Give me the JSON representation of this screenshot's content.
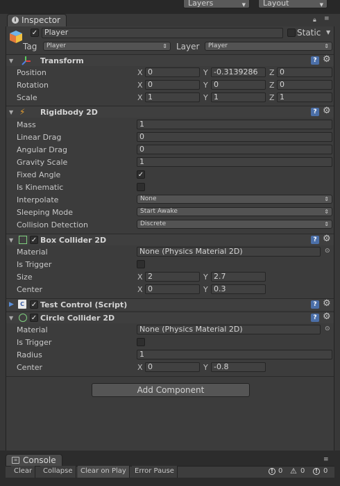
{
  "topbar": {
    "layers_label": "Layers",
    "layout_label": "Layout"
  },
  "inspector": {
    "tab_label": "Inspector",
    "object_name": "Player",
    "static_label": "Static",
    "tag_label": "Tag",
    "tag_value": "Player",
    "layer_label": "Layer",
    "layer_value": "Player"
  },
  "transform": {
    "title": "Transform",
    "position_label": "Position",
    "position": {
      "x": "0",
      "y": "-0.3139286",
      "z": "0"
    },
    "rotation_label": "Rotation",
    "rotation": {
      "x": "0",
      "y": "0",
      "z": "0"
    },
    "scale_label": "Scale",
    "scale": {
      "x": "1",
      "y": "1",
      "z": "1"
    }
  },
  "axis": {
    "x": "X",
    "y": "Y",
    "z": "Z"
  },
  "rigidbody": {
    "title": "Rigidbody 2D",
    "mass_label": "Mass",
    "mass": "1",
    "linear_drag_label": "Linear Drag",
    "linear_drag": "0",
    "angular_drag_label": "Angular Drag",
    "angular_drag": "0",
    "gravity_scale_label": "Gravity Scale",
    "gravity_scale": "1",
    "fixed_angle_label": "Fixed Angle",
    "fixed_angle_mark": "✓",
    "is_kinematic_label": "Is Kinematic",
    "interpolate_label": "Interpolate",
    "interpolate": "None",
    "sleeping_mode_label": "Sleeping Mode",
    "sleeping_mode": "Start Awake",
    "collision_detection_label": "Collision Detection",
    "collision_detection": "Discrete"
  },
  "box_collider": {
    "title": "Box Collider 2D",
    "material_label": "Material",
    "material": "None (Physics Material 2D)",
    "is_trigger_label": "Is Trigger",
    "size_label": "Size",
    "size": {
      "x": "2",
      "y": "2.7"
    },
    "center_label": "Center",
    "center": {
      "x": "0",
      "y": "0.3"
    }
  },
  "test_control": {
    "title": "Test Control (Script)"
  },
  "circle_collider": {
    "title": "Circle Collider 2D",
    "material_label": "Material",
    "material": "None (Physics Material 2D)",
    "is_trigger_label": "Is Trigger",
    "radius_label": "Radius",
    "radius": "1",
    "center_label": "Center",
    "center": {
      "x": "0",
      "y": "-0.8"
    }
  },
  "add_component_label": "Add Component",
  "console": {
    "tab_label": "Console",
    "clear": "Clear",
    "collapse": "Collapse",
    "clear_on_play": "Clear on Play",
    "error_pause": "Error Pause",
    "log_count": "0",
    "warning_count": "0",
    "error_count": "0"
  },
  "colors": {
    "background": "#383838",
    "field": "#414141",
    "header": "#3f3f3f",
    "accent_blue": "#4b6fa8"
  }
}
